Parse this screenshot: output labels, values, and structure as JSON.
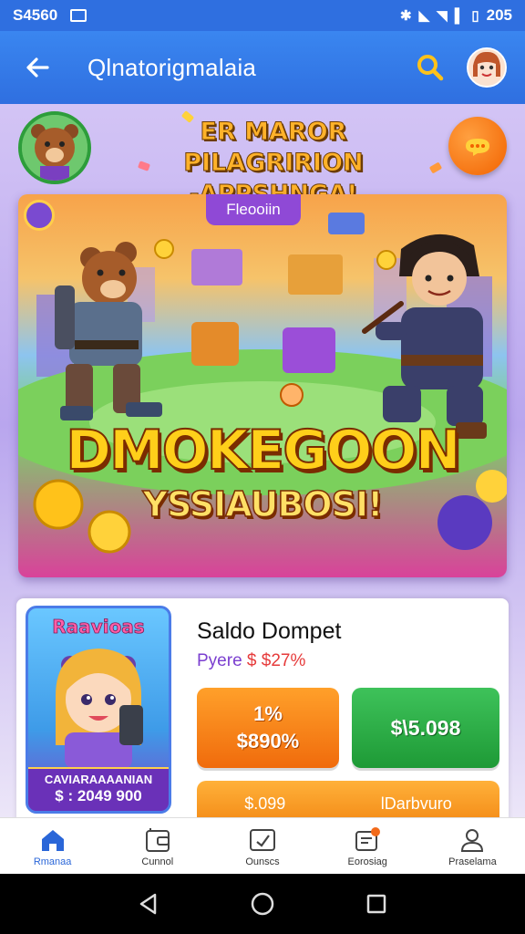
{
  "status_bar": {
    "time_left": "S4560",
    "time_right": "205"
  },
  "app_bar": {
    "title": "Qlnatorigmalaia"
  },
  "promo": {
    "line1": "ER MAROR PILAGRIRION",
    "line2": "-APPSHNGA!"
  },
  "hero": {
    "tag": "Fleooiin",
    "title": "DMOKEGOON",
    "subtitle": "YSSIAUBOSI!"
  },
  "wallet": {
    "card_title": "Raavioas",
    "card_caption": "CAVIARAAAANIAN",
    "card_amount": "$ : 2049 900",
    "title": "Saldo Dompet",
    "sub_label": "Pyere",
    "sub_amount": "$ $27%",
    "btn_orange_line1": "1%",
    "btn_orange_line2": "$890%",
    "btn_green": "$\\5.098",
    "bottom_left": "$.099",
    "bottom_right": "lDarbvuro"
  },
  "bottom_nav": {
    "items": [
      {
        "label": "Rmanaa",
        "icon": "home-icon"
      },
      {
        "label": "Cunnol",
        "icon": "wallet-icon"
      },
      {
        "label": "Ounscs",
        "icon": "card-icon"
      },
      {
        "label": "Eorosiag",
        "icon": "notification-icon"
      },
      {
        "label": "Praselama",
        "icon": "profile-icon"
      }
    ]
  },
  "colors": {
    "primary": "#2f6fe0",
    "accent_orange": "#f06b0c",
    "accent_green": "#1e9a36",
    "accent_purple": "#8f49d6"
  }
}
